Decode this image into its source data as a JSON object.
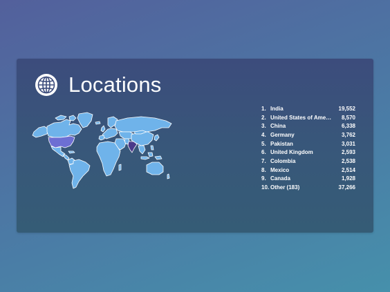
{
  "card": {
    "title": "Locations",
    "icon": "globe-icon"
  },
  "colors": {
    "map_land": "#6fb3ea",
    "map_highlight_usa": "#6d6fd3",
    "map_highlight_india": "#4a3a8a",
    "map_border": "#ffffff"
  },
  "locations": [
    {
      "rank": "1.",
      "country": "India",
      "value": "19,552"
    },
    {
      "rank": "2.",
      "country": "United States of Ame…",
      "value": "8,570"
    },
    {
      "rank": "3.",
      "country": "China",
      "value": "6,338"
    },
    {
      "rank": "4.",
      "country": "Germany",
      "value": "3,762"
    },
    {
      "rank": "5.",
      "country": "Pakistan",
      "value": "3,031"
    },
    {
      "rank": "6.",
      "country": "United Kingdom",
      "value": "2,593"
    },
    {
      "rank": "7.",
      "country": "Colombia",
      "value": "2,538"
    },
    {
      "rank": "8.",
      "country": "Mexico",
      "value": "2,514"
    },
    {
      "rank": "9.",
      "country": "Canada",
      "value": "1,928"
    },
    {
      "rank": "10.",
      "country": "Other (183)",
      "value": "37,266"
    }
  ]
}
